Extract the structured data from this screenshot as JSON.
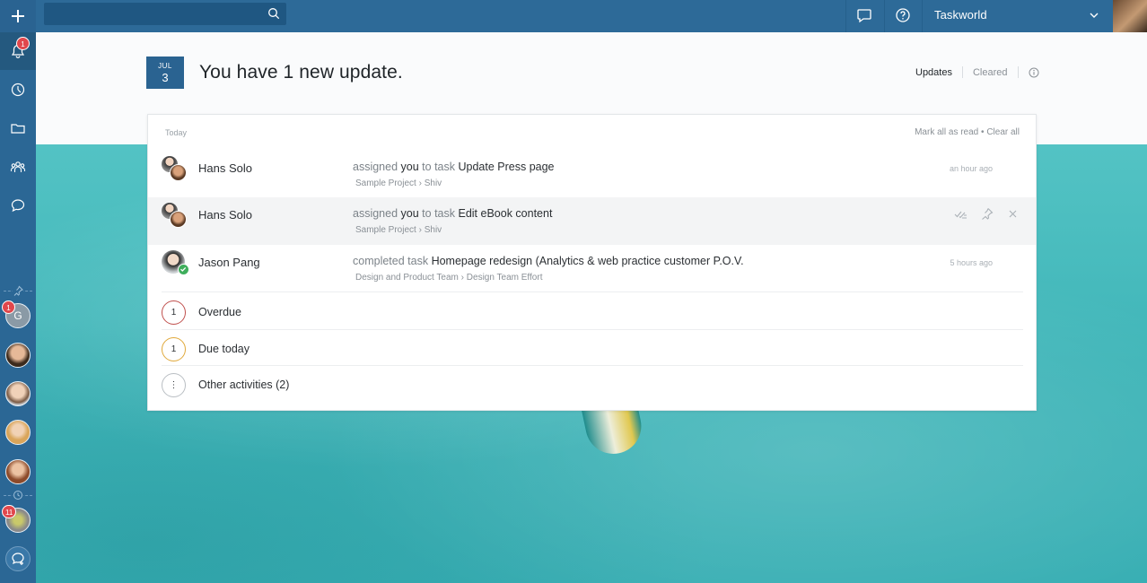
{
  "topbar": {
    "workspace": "Taskworld"
  },
  "sidebar": {
    "notification_badge": "1",
    "group_badge_1": "1",
    "group_badge_2": "11"
  },
  "header": {
    "date_month": "JUL",
    "date_day": "3",
    "title": "You have 1 new update.",
    "tabs": [
      {
        "label": "Updates"
      },
      {
        "label": "Cleared"
      }
    ]
  },
  "panel": {
    "section_label": "Today",
    "mark_all": "Mark all as read",
    "separator": "•",
    "clear_all": "Clear all",
    "updates": [
      {
        "name": "Hans Solo",
        "verb": "assigned",
        "you": "you",
        "middle": "to task",
        "task": "Update Press page",
        "project": "Sample Project",
        "list": "Shiv",
        "time": "an hour ago"
      },
      {
        "name": "Hans Solo",
        "verb": "assigned",
        "you": "you",
        "middle": "to task",
        "task": "Edit eBook content",
        "project": "Sample Project",
        "list": "Shiv",
        "time": ""
      },
      {
        "name": "Jason Pang",
        "verb": "completed task",
        "task": "Homepage redesign (Analytics & web practice customer P.O.V.",
        "project": "Design and Product Team",
        "list": "Design Team Effort",
        "time": "5 hours ago"
      }
    ],
    "counters": [
      {
        "count": "1",
        "label": "Overdue",
        "color": "#c0504d"
      },
      {
        "count": "1",
        "label": "Due today",
        "color": "#e0a93b"
      },
      {
        "count": "⋮",
        "label": "Other activities (2)",
        "color": "#b9bec3"
      }
    ]
  },
  "colors": {
    "brand": "#2d6a98",
    "badge": "#e0474c",
    "check": "#3fae5c"
  }
}
